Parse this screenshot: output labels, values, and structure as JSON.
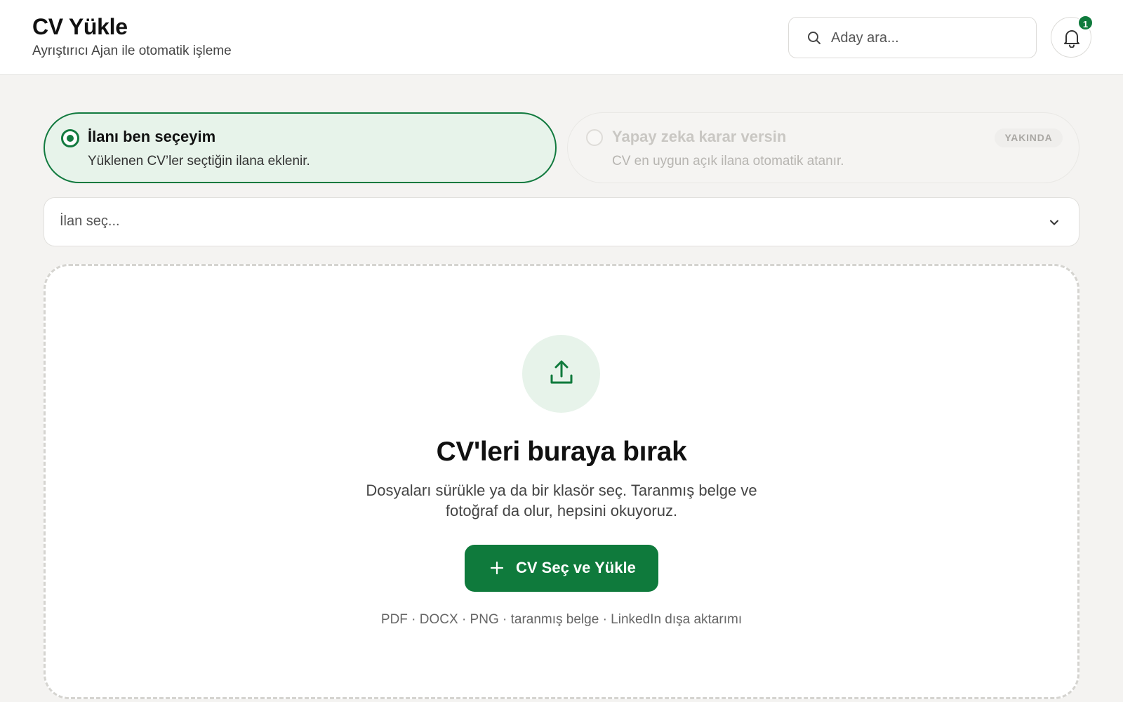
{
  "header": {
    "title": "CV Yükle",
    "subtitle": "Ayrıştırıcı Ajan ile otomatik işleme",
    "search_placeholder": "Aday ara...",
    "notification_count": "1"
  },
  "options": [
    {
      "title": "İlanı ben seçeyim",
      "description": "Yüklenen CV’ler seçtiğin ilana eklenir.",
      "selected": true
    },
    {
      "title": "Yapay zeka karar versin",
      "description": "CV en uygun açık ilana otomatik atanır.",
      "badge": "YAKINDA",
      "selected": false
    }
  ],
  "job_select": {
    "placeholder": "İlan seç..."
  },
  "dropzone": {
    "title": "CV'leri buraya bırak",
    "description_line1": "Dosyaları sürükle ya da bir klasör seç. Taranmış belge ve",
    "description_line2": "fotoğraf da olur, hepsini okuyoruz.",
    "button_label": "CV Seç ve Yükle",
    "formats": "PDF · DOCX · PNG · taranmış belge · LinkedIn dışa aktarımı"
  },
  "colors": {
    "accent": "#0f7a3c",
    "accent_light": "#e7f3ea",
    "background": "#f4f3f1"
  },
  "icons": {
    "search": "search-icon",
    "bell": "bell-icon",
    "chevron": "chevron-down-icon",
    "upload": "upload-icon",
    "plus": "plus-icon"
  }
}
